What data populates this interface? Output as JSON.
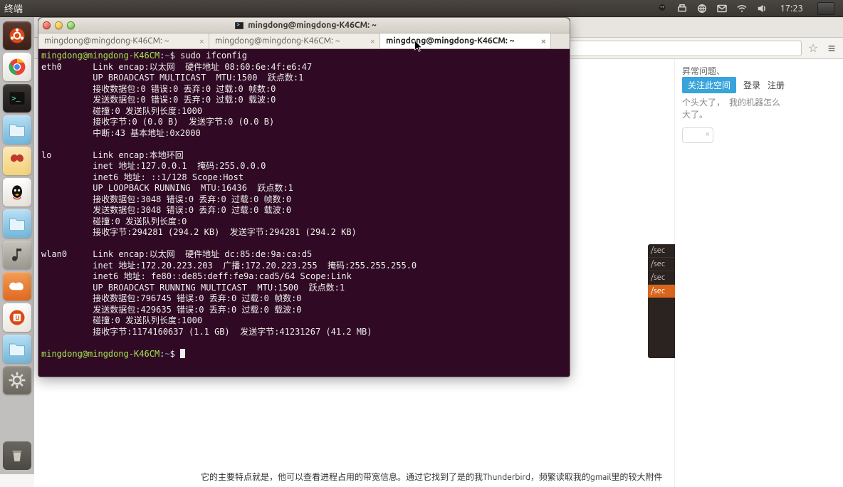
{
  "menubar": {
    "app_label": "终端",
    "clock": "17:23"
  },
  "launcher": {
    "items": [
      {
        "name": "dash",
        "bg": "linear-gradient(#5c3a31,#3a2019)",
        "icon": "ubuntu"
      },
      {
        "name": "chrome",
        "bg": "linear-gradient(#fefefe,#e9e6df)",
        "icon": "chrome"
      },
      {
        "name": "terminal",
        "bg": "linear-gradient(#3a3632,#1e1b18)",
        "icon": "terminal"
      },
      {
        "name": "files",
        "bg": "linear-gradient(#b8e0f5,#73b6da)",
        "icon": "folder"
      },
      {
        "name": "butterfly",
        "bg": "linear-gradient(#fbe8b6,#f4d37a)",
        "icon": "butterfly"
      },
      {
        "name": "qq",
        "bg": "linear-gradient(#fefefe,#e6e3dc)",
        "icon": "qq"
      },
      {
        "name": "folder2",
        "bg": "linear-gradient(#b8e0f5,#73b6da)",
        "icon": "folder"
      },
      {
        "name": "music",
        "bg": "linear-gradient(#c8c4bd,#9b968e)",
        "icon": "music"
      },
      {
        "name": "ubuntuone",
        "bg": "linear-gradient(#f09d58,#e06a1f)",
        "icon": "cloud"
      },
      {
        "name": "software",
        "bg": "linear-gradient(#fefefe,#ece8e0)",
        "icon": "usc"
      },
      {
        "name": "folder3",
        "bg": "linear-gradient(#b8e0f5,#73b6da)",
        "icon": "folder"
      },
      {
        "name": "settings",
        "bg": "linear-gradient(#8d8880,#6b665e)",
        "icon": "gear"
      }
    ]
  },
  "browser": {
    "header": {
      "follow_btn": "关注此空间",
      "login": "登录",
      "register": "注册",
      "snippet1": "昇常问题、",
      "snippet2": "个头大了，",
      "snippet3": "我的机器怎么",
      "snippet4": "大了。"
    },
    "strip": {
      "l1": "/sec",
      "l2": "/sec",
      "l3": "/sec",
      "l4": "/sec"
    },
    "footer": "它的主要特点就是，他可以查看进程占用的带宽信息。通过它找到了是的我Thunderbird，频繁读取我的gmail里的较大附件"
  },
  "terminal": {
    "window_title": "mingdong@mingdong-K46CM: ~",
    "tabs": [
      {
        "label": "mingdong@mingdong-K46CM: ~",
        "active": false
      },
      {
        "label": "mingdong@mingdong-K46CM: ~",
        "active": false
      },
      {
        "label": "mingdong@mingdong-K46CM: ~",
        "active": true
      }
    ],
    "tooltip": "mingdong@mingdong-K46CM: ~",
    "prompt_user": "mingdong@mingdong-K46CM",
    "prompt_path": "~",
    "command": "sudo ifconfig",
    "output_lines": [
      "eth0      Link encap:以太网  硬件地址 08:60:6e:4f:e6:47  ",
      "          UP BROADCAST MULTICAST  MTU:1500  跃点数:1",
      "          接收数据包:0 错误:0 丢弃:0 过载:0 帧数:0",
      "          发送数据包:0 错误:0 丢弃:0 过载:0 载波:0",
      "          碰撞:0 发送队列长度:1000 ",
      "          接收字节:0 (0.0 B)  发送字节:0 (0.0 B)",
      "          中断:43 基本地址:0x2000 ",
      "",
      "lo        Link encap:本地环回  ",
      "          inet 地址:127.0.0.1  掩码:255.0.0.0",
      "          inet6 地址: ::1/128 Scope:Host",
      "          UP LOOPBACK RUNNING  MTU:16436  跃点数:1",
      "          接收数据包:3048 错误:0 丢弃:0 过载:0 帧数:0",
      "          发送数据包:3048 错误:0 丢弃:0 过载:0 载波:0",
      "          碰撞:0 发送队列长度:0 ",
      "          接收字节:294281 (294.2 KB)  发送字节:294281 (294.2 KB)",
      "",
      "wlan0     Link encap:以太网  硬件地址 dc:85:de:9a:ca:d5  ",
      "          inet 地址:172.20.223.203  广播:172.20.223.255  掩码:255.255.255.0",
      "          inet6 地址: fe80::de85:deff:fe9a:cad5/64 Scope:Link",
      "          UP BROADCAST RUNNING MULTICAST  MTU:1500  跃点数:1",
      "          接收数据包:796745 错误:0 丢弃:0 过载:0 帧数:0",
      "          发送数据包:429635 错误:0 丢弃:0 过载:0 载波:0",
      "          碰撞:0 发送队列长度:1000 ",
      "          接收字节:1174160637 (1.1 GB)  发送字节:41231267 (41.2 MB)",
      ""
    ]
  }
}
